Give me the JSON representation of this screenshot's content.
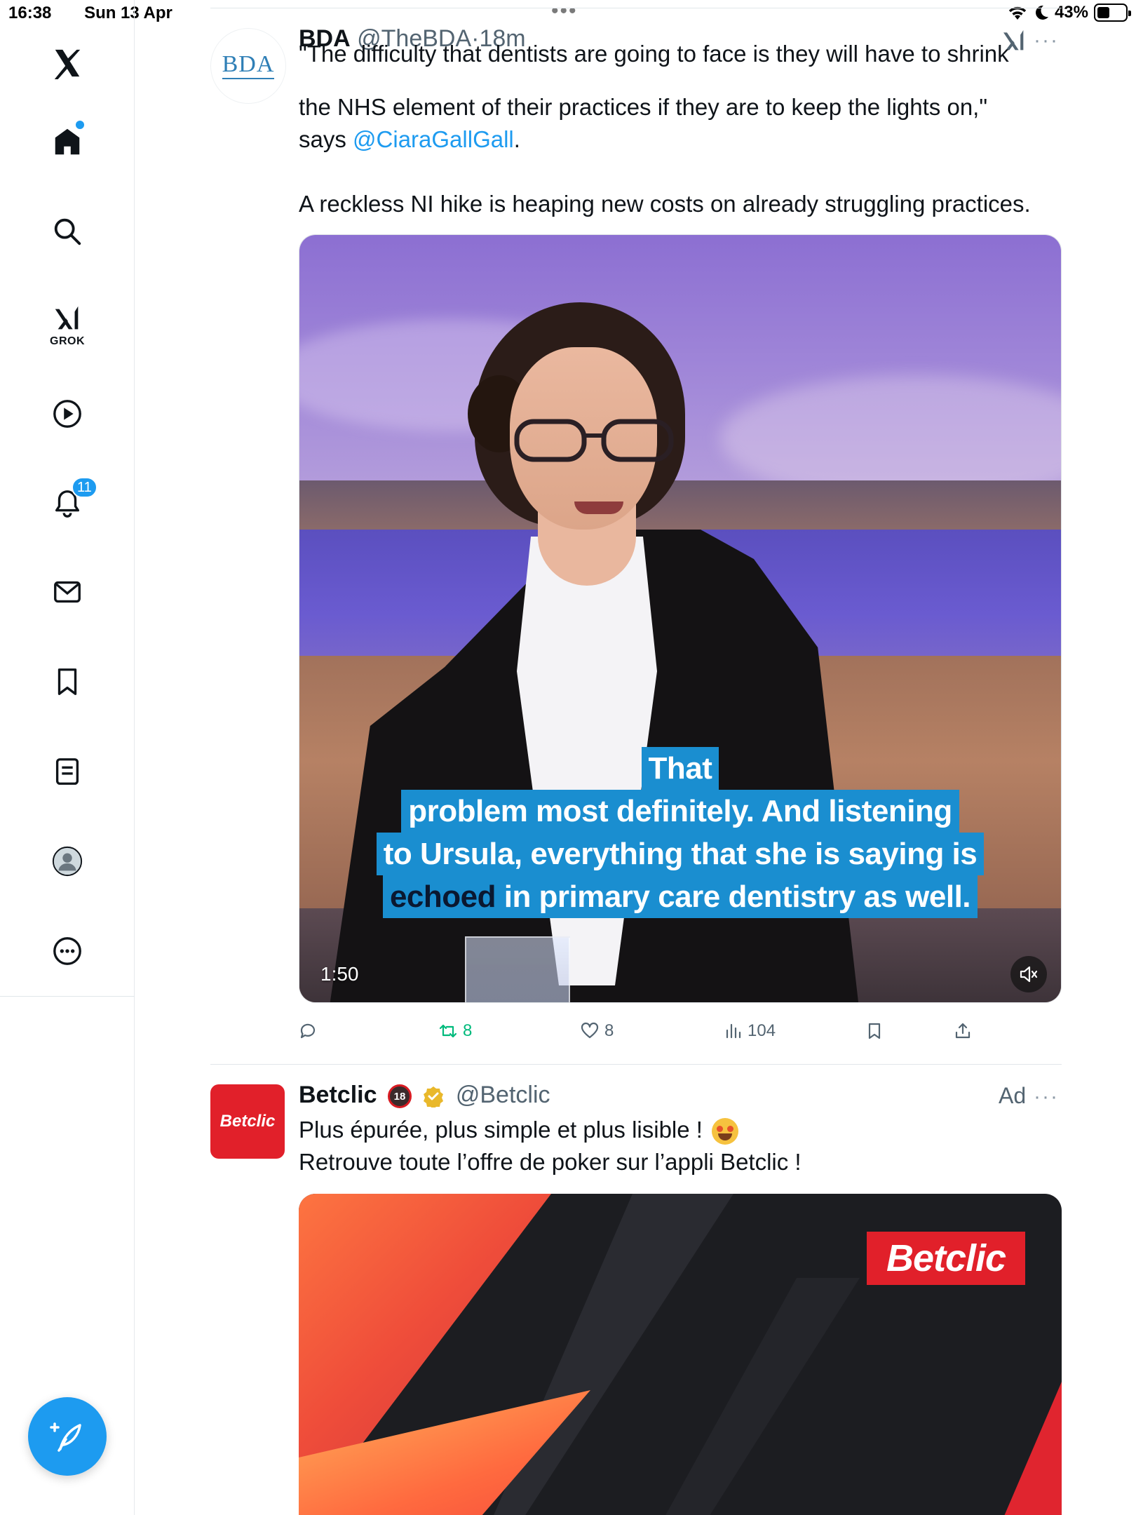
{
  "status_bar": {
    "time": "16:38",
    "date": "Sun 13 Apr",
    "battery": "43%"
  },
  "sidebar": {
    "items": [
      {
        "name": "x-logo"
      },
      {
        "name": "home",
        "has_dot": true
      },
      {
        "name": "search"
      },
      {
        "name": "grok",
        "label": "GROK"
      },
      {
        "name": "videos"
      },
      {
        "name": "notifications",
        "badge": "11"
      },
      {
        "name": "messages"
      },
      {
        "name": "bookmarks"
      },
      {
        "name": "lists"
      },
      {
        "name": "profile"
      },
      {
        "name": "more"
      }
    ]
  },
  "tweet1": {
    "avatar_text": "BDA",
    "name": "BDA",
    "handle": "@TheBDA",
    "time": "18m",
    "line1": "\"The difficulty that dentists are going to face is they will have to shrink",
    "line2": "the NHS element of their practices if they are to keep the lights on,\"",
    "line3_pre": "says ",
    "mention": "@CiaraGallGall",
    "line3_post": ".",
    "line4": "A reckless NI hike is heaping new costs on already struggling practices.",
    "video": {
      "caption_1": "That",
      "caption_2": "problem most definitely. And listening",
      "caption_3": "to Ursula, everything that she is saying is",
      "caption_4a": "echoed",
      "caption_4b": " in primary care dentistry as well.",
      "duration": "1:50"
    },
    "stats": {
      "replies": "",
      "retweets": "8",
      "likes": "8",
      "views": "104"
    }
  },
  "tweet2": {
    "avatar_text": "Betclic",
    "name": "Betclic",
    "age_badge": "18",
    "handle": "@Betclic",
    "ad_label": "Ad",
    "line1": "Plus épurée, plus simple et plus lisible !",
    "line2": "Retrouve toute l’offre de poker sur l’appli Betclic !",
    "media_logo": "Betclic"
  },
  "colors": {
    "accent": "#1d9bf0",
    "retweet": "#00ba7c",
    "betclic": "#e1202a"
  }
}
